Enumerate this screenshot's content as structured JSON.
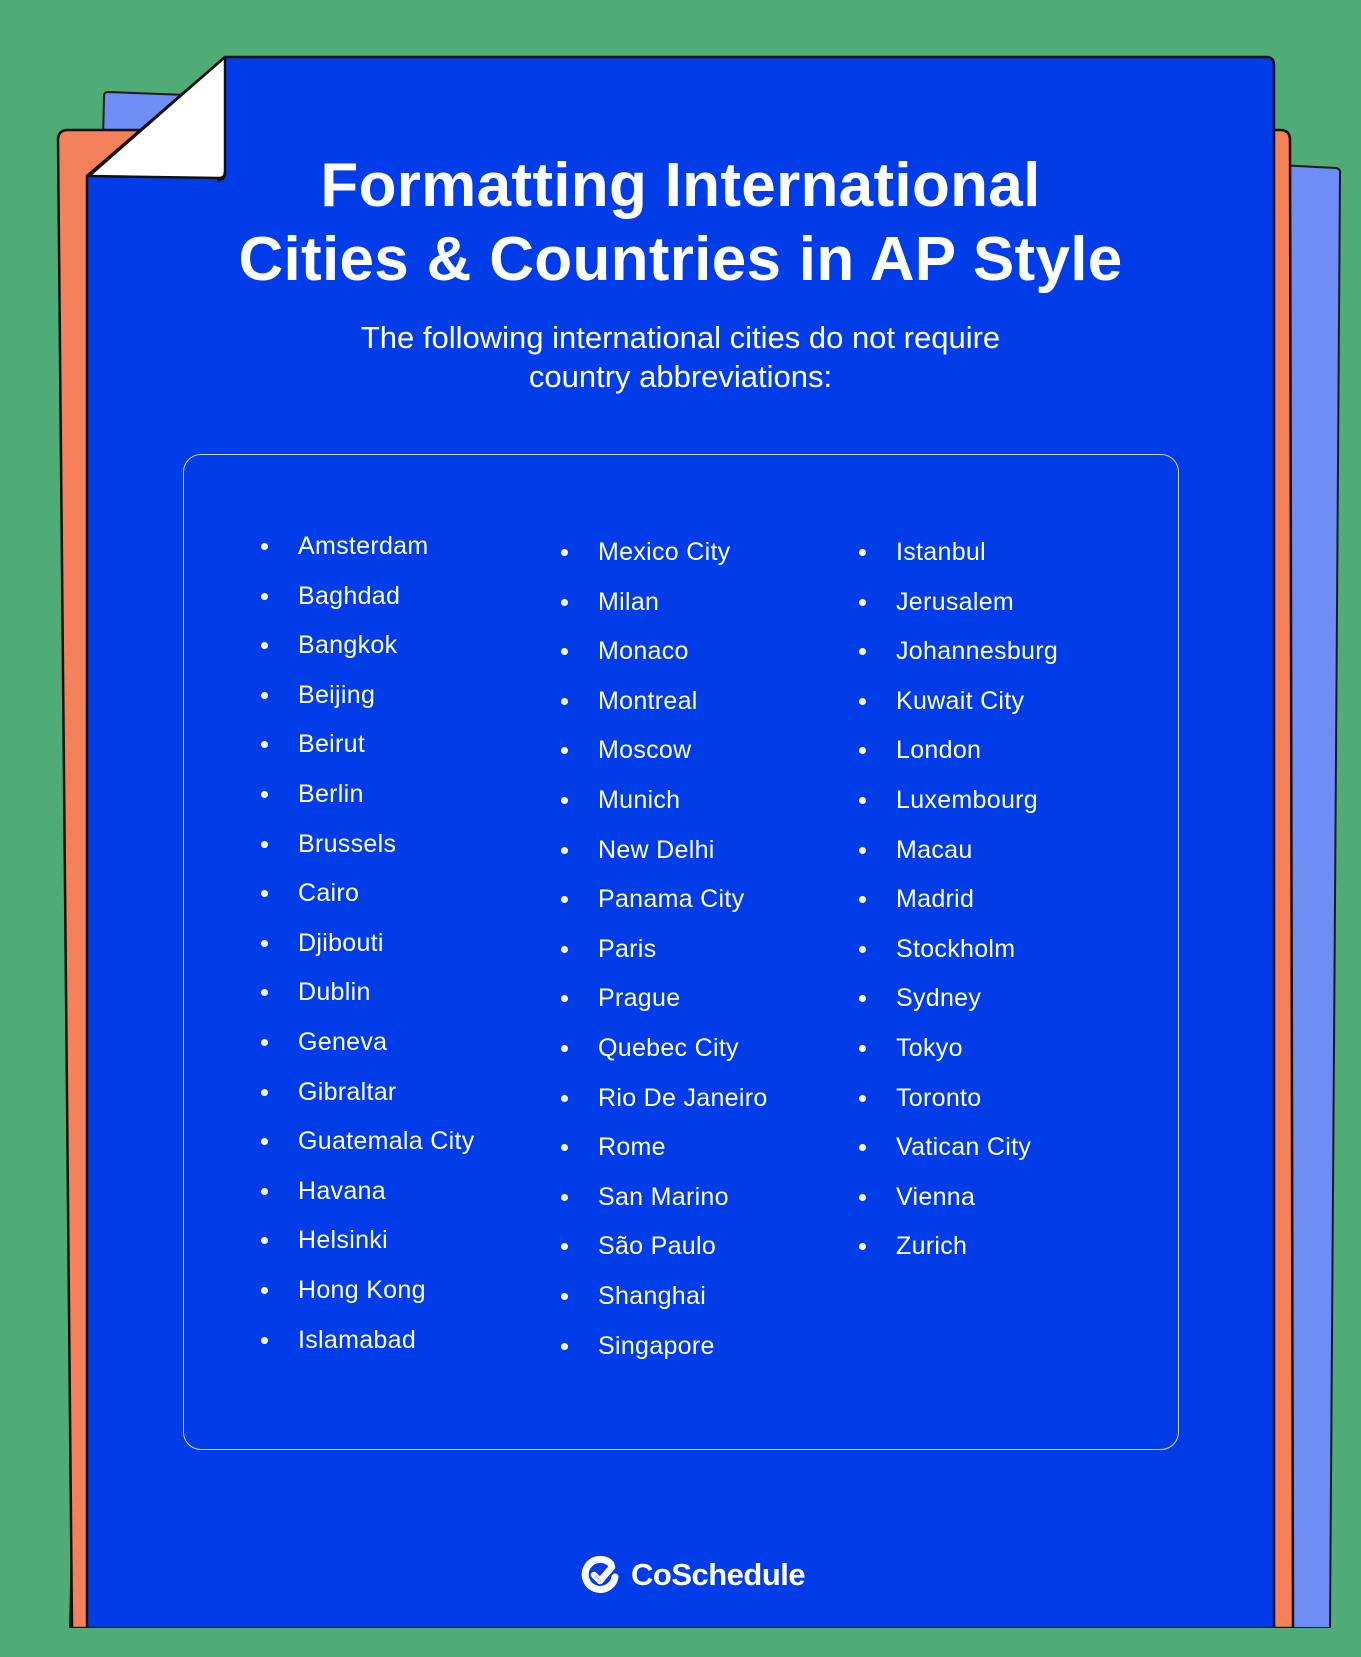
{
  "header": {
    "title_lines": [
      "Formatting International",
      "Cities & Countries in AP Style"
    ],
    "subtitle_lines": [
      "The following international cities do not require",
      "country abbreviations:"
    ]
  },
  "cities": {
    "column1": [
      "Amsterdam",
      "Baghdad",
      "Bangkok",
      "Beijing",
      "Beirut",
      "Berlin",
      "Brussels",
      "Cairo",
      "Djibouti",
      "Dublin",
      "Geneva",
      "Gibraltar",
      "Guatemala City",
      "Havana",
      "Helsinki",
      "Hong Kong",
      "Islamabad"
    ],
    "column2": [
      "Mexico City",
      "Milan",
      "Monaco",
      "Montreal",
      "Moscow",
      "Munich",
      "New Delhi",
      "Panama City",
      "Paris",
      "Prague",
      "Quebec City",
      "Rio De Janeiro",
      "Rome",
      "San Marino",
      "São Paulo",
      "Shanghai",
      "Singapore"
    ],
    "column3": [
      "Istanbul",
      "Jerusalem",
      "Johannesburg",
      "Kuwait City",
      "London",
      "Luxembourg",
      "Macau",
      "Madrid",
      "Stockholm",
      "Sydney",
      "Tokyo",
      "Toronto",
      "Vatican City",
      "Vienna",
      "Zurich"
    ]
  },
  "footer": {
    "brand_name": "CoSchedule",
    "brand_icon": "checkmark-logo-icon"
  },
  "colors": {
    "background": "#4fac76",
    "main_sheet": "#003de9",
    "orange_sheet": "#f4815a",
    "light_blue_sheet": "#6e8df5",
    "page_curl": "#ffffff",
    "text": "#ffffff"
  }
}
